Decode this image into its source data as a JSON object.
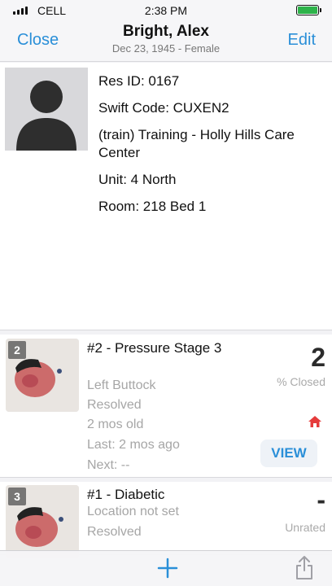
{
  "status_bar": {
    "carrier": "CELL",
    "time": "2:38 PM",
    "battery_color": "#2db34a"
  },
  "nav": {
    "close_label": "Close",
    "edit_label": "Edit",
    "title": "Bright, Alex",
    "subtitle": "Dec 23, 1945 - Female",
    "accent_color": "#2a8fd8"
  },
  "patient": {
    "avatar_icon": "person-silhouette-icon",
    "res_id": "Res ID: 0167",
    "swift_code": "Swift Code: CUXEN2",
    "facility": "(train) Training - Holly Hills Care Center",
    "unit": "Unit: 4 North",
    "room": "Room: 218 Bed 1"
  },
  "wounds": [
    {
      "badge": "2",
      "title": "#2 - Pressure Stage 3",
      "location": "Left Buttock",
      "status": "Resolved",
      "age": "2 mos old",
      "last": "Last: 2 mos ago",
      "next": "Next: --",
      "score": "2",
      "score_label": "% Closed",
      "home_icon": "home-icon",
      "view_label": "VIEW"
    },
    {
      "badge": "3",
      "title": "#1 - Diabetic",
      "location": "Location not set",
      "status": "Resolved",
      "score": "-",
      "score_label": "Unrated"
    }
  ],
  "toolbar": {
    "add_icon": "plus-icon",
    "share_icon": "share-icon"
  }
}
